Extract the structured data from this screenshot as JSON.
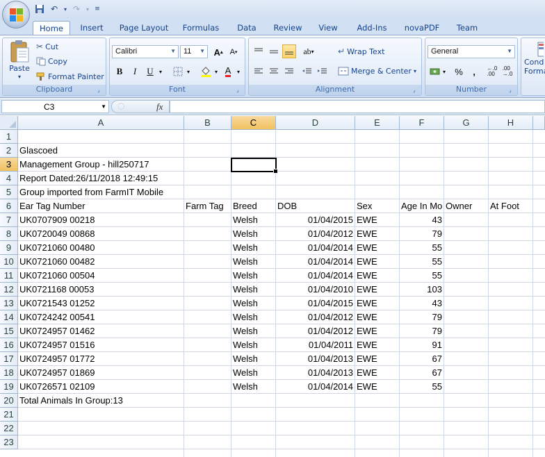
{
  "tabs": [
    "Home",
    "Insert",
    "Page Layout",
    "Formulas",
    "Data",
    "Review",
    "View",
    "Add-Ins",
    "novaPDF",
    "Team"
  ],
  "active_tab": "Home",
  "clipboard": {
    "paste": "Paste",
    "cut": "Cut",
    "copy": "Copy",
    "format_painter": "Format Painter",
    "label": "Clipboard"
  },
  "font": {
    "name": "Calibri",
    "size": "11",
    "label": "Font"
  },
  "alignment": {
    "wrap": "Wrap Text",
    "merge": "Merge & Center",
    "label": "Alignment"
  },
  "number": {
    "format": "General",
    "label": "Number",
    "percent": "%",
    "comma": ","
  },
  "styles_partial": {
    "line1": "Cond",
    "line2": "Forma"
  },
  "name_box": "C3",
  "fx": "fx",
  "columns": [
    "A",
    "B",
    "C",
    "D",
    "E",
    "F",
    "G",
    "H"
  ],
  "rows": [
    "1",
    "2",
    "3",
    "4",
    "5",
    "6",
    "7",
    "8",
    "9",
    "10",
    "11",
    "12",
    "13",
    "14",
    "15",
    "16",
    "17",
    "18",
    "19",
    "20",
    "21",
    "22",
    "23"
  ],
  "cells": {
    "r2": "Glascoed",
    "r3": "Management Group - hill250717",
    "r4": "Report Dated:26/11/2018 12:49:15",
    "r5": "Group imported from FarmIT Mobile",
    "r20": "Total Animals In Group:13"
  },
  "headers": {
    "a": "Ear Tag Number",
    "b": "Farm Tag",
    "c": "Breed",
    "d": "DOB",
    "e": "Sex",
    "f": "Age In Mo",
    "g": "Owner",
    "h": "At Foot"
  },
  "records": [
    {
      "tag": "UK0707909 00218",
      "breed": "Welsh",
      "dob": "01/04/2015",
      "sex": "EWE",
      "age": "43"
    },
    {
      "tag": "UK0720049 00868",
      "breed": "Welsh",
      "dob": "01/04/2012",
      "sex": "EWE",
      "age": "79"
    },
    {
      "tag": "UK0721060 00480",
      "breed": "Welsh",
      "dob": "01/04/2014",
      "sex": "EWE",
      "age": "55"
    },
    {
      "tag": "UK0721060 00482",
      "breed": "Welsh",
      "dob": "01/04/2014",
      "sex": "EWE",
      "age": "55"
    },
    {
      "tag": "UK0721060 00504",
      "breed": "Welsh",
      "dob": "01/04/2014",
      "sex": "EWE",
      "age": "55"
    },
    {
      "tag": "UK0721168 00053",
      "breed": "Welsh",
      "dob": "01/04/2010",
      "sex": "EWE",
      "age": "103"
    },
    {
      "tag": "UK0721543 01252",
      "breed": "Welsh",
      "dob": "01/04/2015",
      "sex": "EWE",
      "age": "43"
    },
    {
      "tag": "UK0724242 00541",
      "breed": "Welsh",
      "dob": "01/04/2012",
      "sex": "EWE",
      "age": "79"
    },
    {
      "tag": "UK0724957 01462",
      "breed": "Welsh",
      "dob": "01/04/2012",
      "sex": "EWE",
      "age": "79"
    },
    {
      "tag": "UK0724957 01516",
      "breed": "Welsh",
      "dob": "01/04/2011",
      "sex": "EWE",
      "age": "91"
    },
    {
      "tag": "UK0724957 01772",
      "breed": "Welsh",
      "dob": "01/04/2013",
      "sex": "EWE",
      "age": "67"
    },
    {
      "tag": "UK0724957 01869",
      "breed": "Welsh",
      "dob": "01/04/2013",
      "sex": "EWE",
      "age": "67"
    },
    {
      "tag": "UK0726571 02109",
      "breed": "Welsh",
      "dob": "01/04/2014",
      "sex": "EWE",
      "age": "55"
    }
  ]
}
